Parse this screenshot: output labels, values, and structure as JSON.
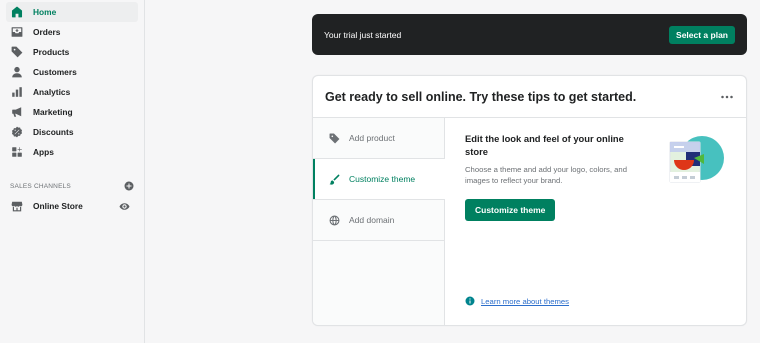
{
  "sidebar": {
    "items": [
      {
        "label": "Home",
        "icon": "home-icon",
        "active": true
      },
      {
        "label": "Orders",
        "icon": "orders-icon"
      },
      {
        "label": "Products",
        "icon": "tag-icon"
      },
      {
        "label": "Customers",
        "icon": "person-icon"
      },
      {
        "label": "Analytics",
        "icon": "analytics-icon"
      },
      {
        "label": "Marketing",
        "icon": "megaphone-icon"
      },
      {
        "label": "Discounts",
        "icon": "discount-icon"
      },
      {
        "label": "Apps",
        "icon": "apps-icon"
      }
    ],
    "sales_channels_title": "SALES CHANNELS",
    "online_store": {
      "label": "Online Store",
      "icon": "store-icon"
    }
  },
  "banner": {
    "text": "Your trial just started",
    "button": "Select a plan"
  },
  "setup": {
    "title": "Get ready to sell online. Try these tips to get started.",
    "tabs": [
      {
        "label": "Add product",
        "icon": "tag-icon"
      },
      {
        "label": "Customize theme",
        "icon": "paintbrush-icon",
        "active": true
      },
      {
        "label": "Add domain",
        "icon": "globe-icon"
      }
    ],
    "panel": {
      "title": "Edit the look and feel of your online store",
      "description": "Choose a theme and add your logo, colors, and images to reflect your brand.",
      "button": "Customize theme",
      "learn_more": "Learn more about themes"
    }
  },
  "colors": {
    "accent": "#008060",
    "banner_bg": "#202223",
    "link": "#2c6ecb"
  }
}
